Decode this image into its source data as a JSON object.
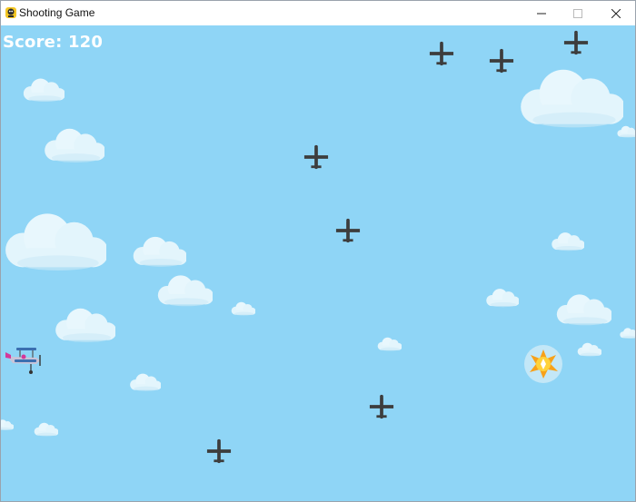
{
  "window": {
    "title": "Shooting Game",
    "controls": {
      "minimize": "minimize-icon",
      "maximize": "maximize-icon",
      "close": "close-icon"
    }
  },
  "game": {
    "score_text": "Score: 120",
    "sky_color": "#8fd5f6",
    "cloud_color": "#e3f5fc",
    "enemy_color": "#3d3d3d"
  }
}
